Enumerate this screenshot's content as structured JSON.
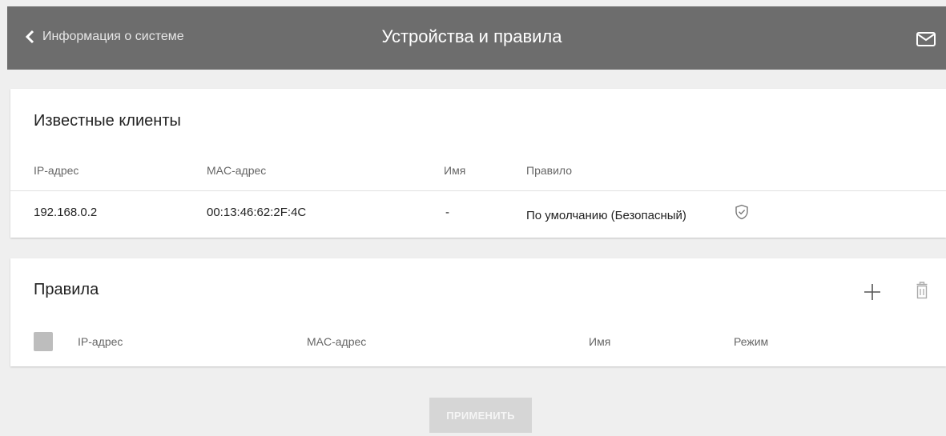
{
  "header": {
    "back_label": "Информация о системе",
    "title": "Устройства и правила",
    "mail_icon": "mail-icon"
  },
  "known_clients": {
    "title": "Известные клиенты",
    "columns": {
      "ip": "IP-адрес",
      "mac": "MAC-адрес",
      "name": "Имя",
      "rule": "Правило"
    },
    "rows": [
      {
        "ip": "192.168.0.2",
        "mac": "00:13:46:62:2F:4C",
        "name": "-",
        "rule": "По умолчанию (Безопасный)",
        "rule_icon": "shield-check-icon"
      }
    ]
  },
  "rules": {
    "title": "Правила",
    "columns": {
      "ip": "IP-адрес",
      "mac": "MAC-адрес",
      "name": "Имя",
      "mode": "Режим"
    },
    "add_icon": "plus-icon",
    "delete_icon": "trash-icon"
  },
  "apply_label": "ПРИМЕНИТЬ",
  "colors": {
    "header_bg": "#6d6d6d",
    "page_bg": "#efefef",
    "card_bg": "#ffffff",
    "apply_disabled_bg": "#d6d6d6"
  }
}
